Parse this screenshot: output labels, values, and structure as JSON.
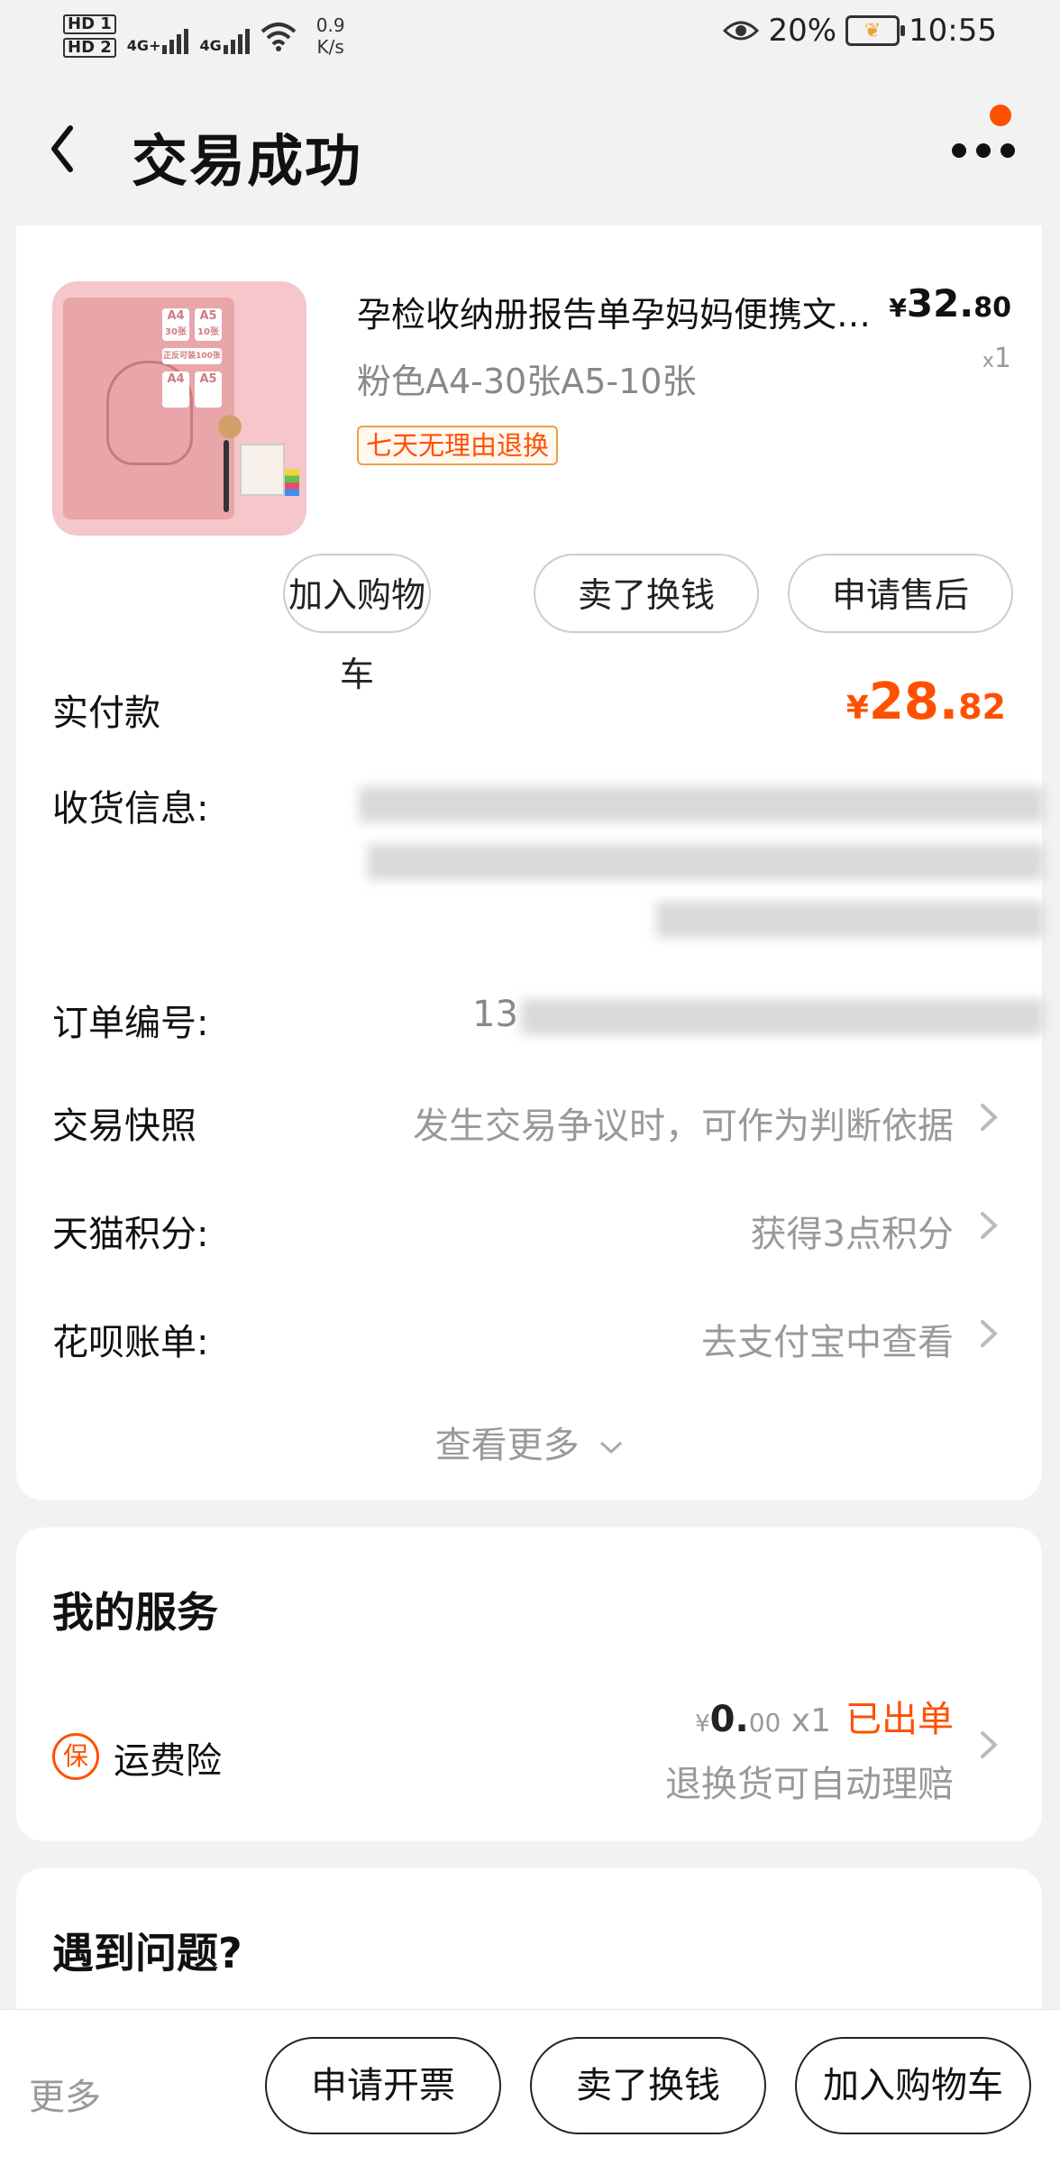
{
  "status_bar": {
    "hd1": "HD 1",
    "hd2": "HD 2",
    "sim1": "4G+",
    "sim2": "4G",
    "net_speed_value": "0.9",
    "net_speed_unit": "K/s",
    "battery_percent": "20%",
    "time": "10:55"
  },
  "header": {
    "title": "交易成功"
  },
  "product": {
    "title": "孕检收纳册报告单孕妈妈便携文件夹",
    "spec": "粉色A4-30张A5-10张",
    "badge": "七天无理由退换",
    "price_symbol": "¥",
    "price_int": "32.",
    "price_dec": "80",
    "qty_x": "x",
    "qty": "1",
    "image_tags": [
      "A4",
      "30张",
      "A5",
      "10张",
      "正反可装100张",
      "A4",
      "A5"
    ]
  },
  "actions": {
    "add_cart": "加入购物车",
    "sell": "卖了换钱",
    "after_sale": "申请售后"
  },
  "order": {
    "paid_label": "实付款",
    "paid_symbol": "¥",
    "paid_int": "28.",
    "paid_dec": "82",
    "shipping_label": "收货信息:",
    "order_no_label": "订单编号:",
    "order_no_prefix": "13",
    "snapshot_label": "交易快照",
    "snapshot_value": "发生交易争议时，可作为判断依据",
    "points_label": "天猫积分:",
    "points_value": "获得3点积分",
    "huabei_label": "花呗账单:",
    "huabei_value": "去支付宝中查看",
    "see_more": "查看更多"
  },
  "services": {
    "title": "我的服务",
    "icon_char": "保",
    "insurance_label": "运费险",
    "price_symbol": "¥",
    "price_int": "0.",
    "price_dec": "00",
    "qty": "x1",
    "status": "已出单",
    "desc": "退换货可自动理赔"
  },
  "problem": {
    "title": "遇到问题?"
  },
  "bottom_bar": {
    "more": "更多",
    "invoice": "申请开票",
    "sell": "卖了换钱",
    "add_cart": "加入购物车"
  }
}
